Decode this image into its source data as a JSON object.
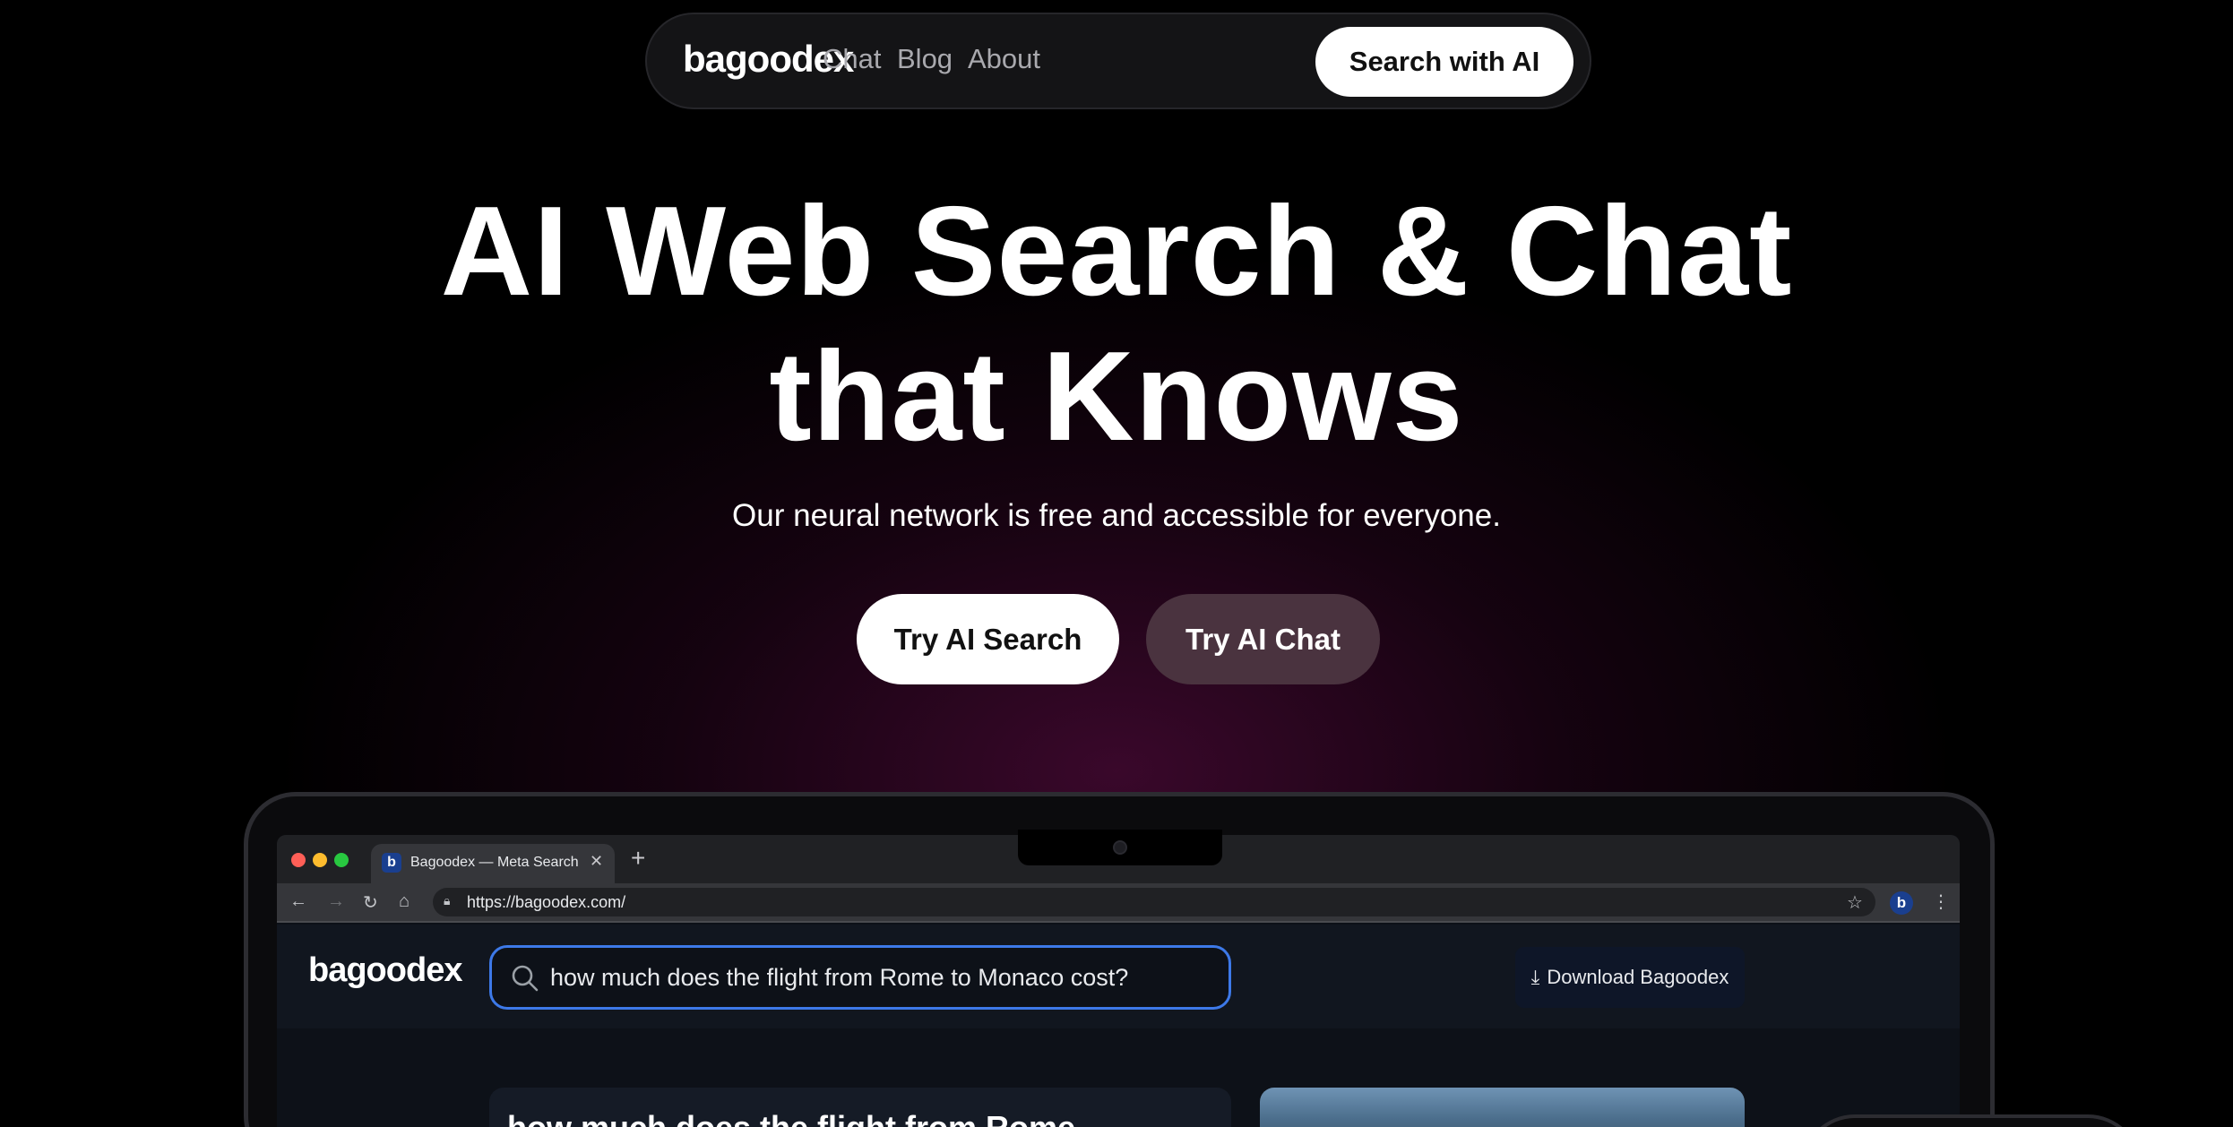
{
  "nav": {
    "logo": "bagoodex",
    "links": [
      "Chat",
      "Blog",
      "About"
    ],
    "cta": "Search with AI"
  },
  "hero": {
    "title_line1": "AI Web Search & Chat",
    "title_line2": "that Knows",
    "subtitle": "Our neural network is free and accessible for everyone.",
    "primary_button": "Try AI Search",
    "secondary_button": "Try AI Chat"
  },
  "browser": {
    "tab_favicon": "b",
    "tab_title": "Bagoodex — Meta Search",
    "url": "https://bagoodex.com/",
    "extension_badge": "b"
  },
  "site": {
    "logo": "bagoodex",
    "search_query": "how much does the flight from Rome to Monaco cost?",
    "download_label": "Download Bagoodex",
    "result_title": "how much does the flight from Rome"
  },
  "colors": {
    "background": "#000000",
    "glow": "#690e4e",
    "secondary_button": "#4a333f",
    "search_border": "#3d79e8"
  }
}
